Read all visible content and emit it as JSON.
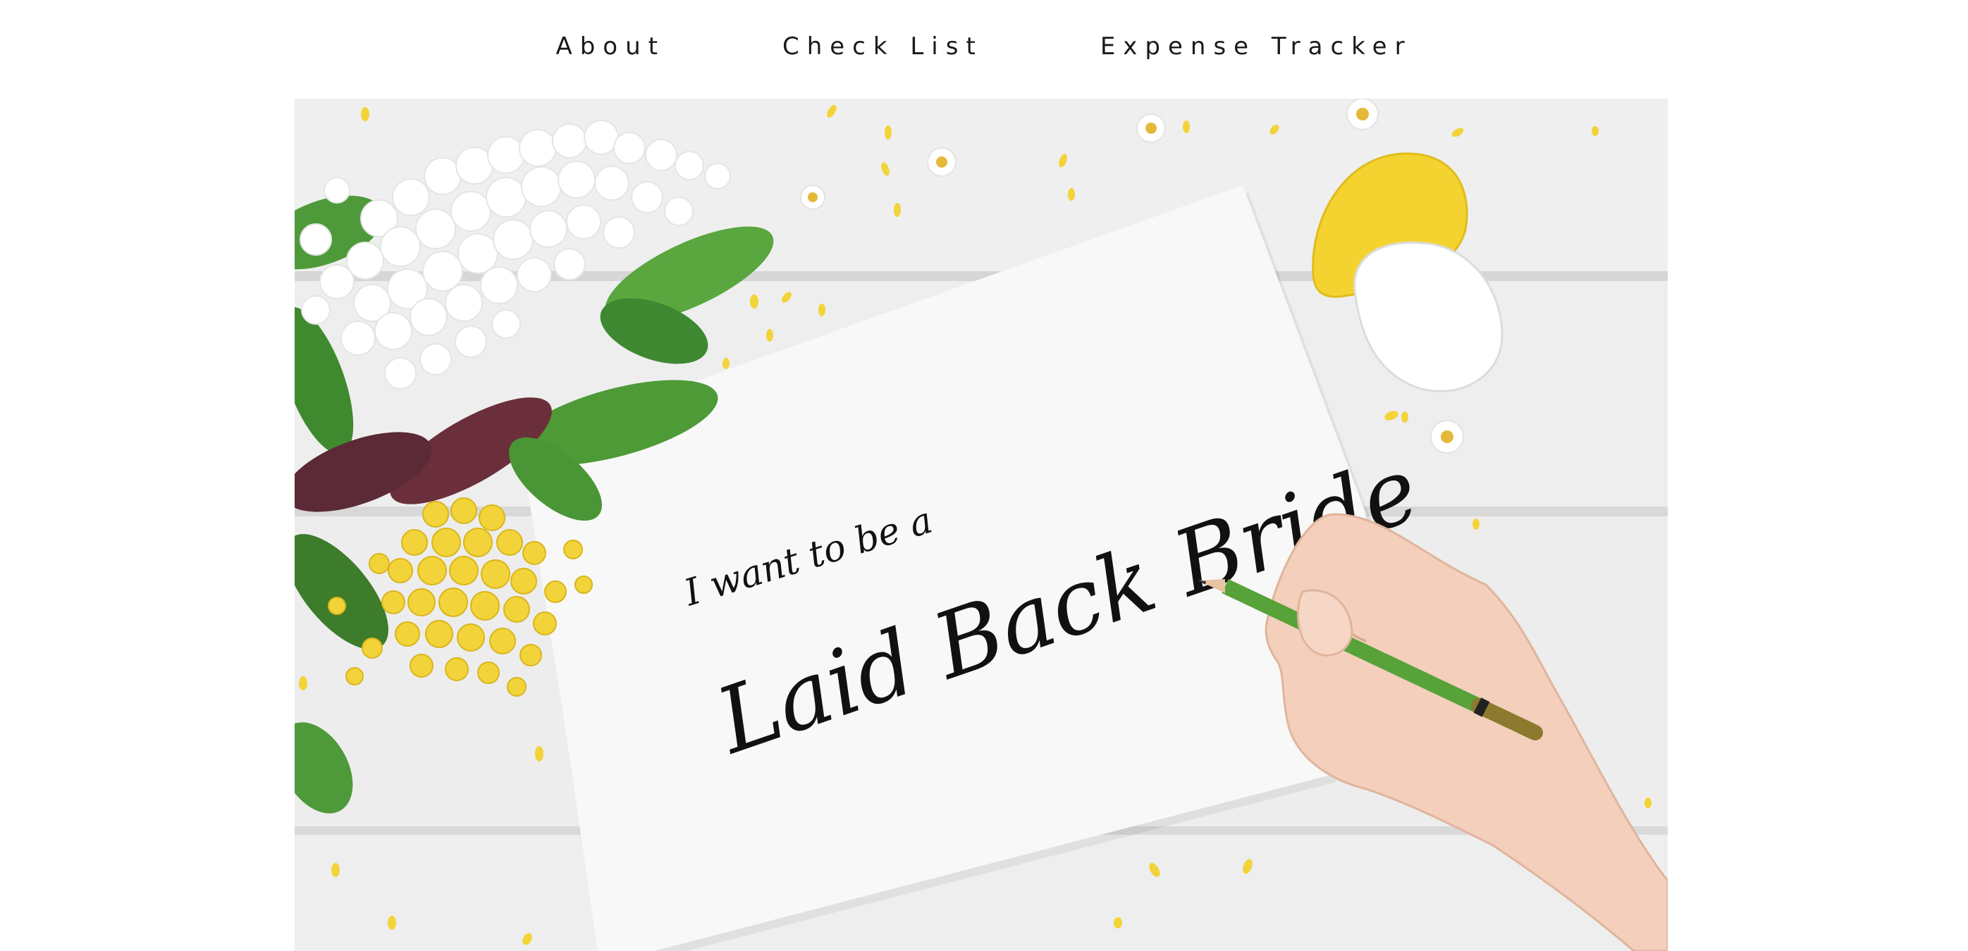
{
  "nav": {
    "items": [
      {
        "label": "About"
      },
      {
        "label": "Check List"
      },
      {
        "label": "Expense Tracker"
      }
    ]
  },
  "hero": {
    "handwriting_small": "I want to be a",
    "handwriting_big": "Laid Back Bride"
  },
  "colors": {
    "background": "#ffffff",
    "nav_text": "#1a1a1a",
    "table_wood": "#ebebeb",
    "paper": "#f8f8f8",
    "lilac_white": "#ffffff",
    "leaf_green": "#4e9a3a",
    "flower_yellow": "#f2d43a",
    "pencil_green": "#58a23a",
    "ink": "#111111"
  }
}
